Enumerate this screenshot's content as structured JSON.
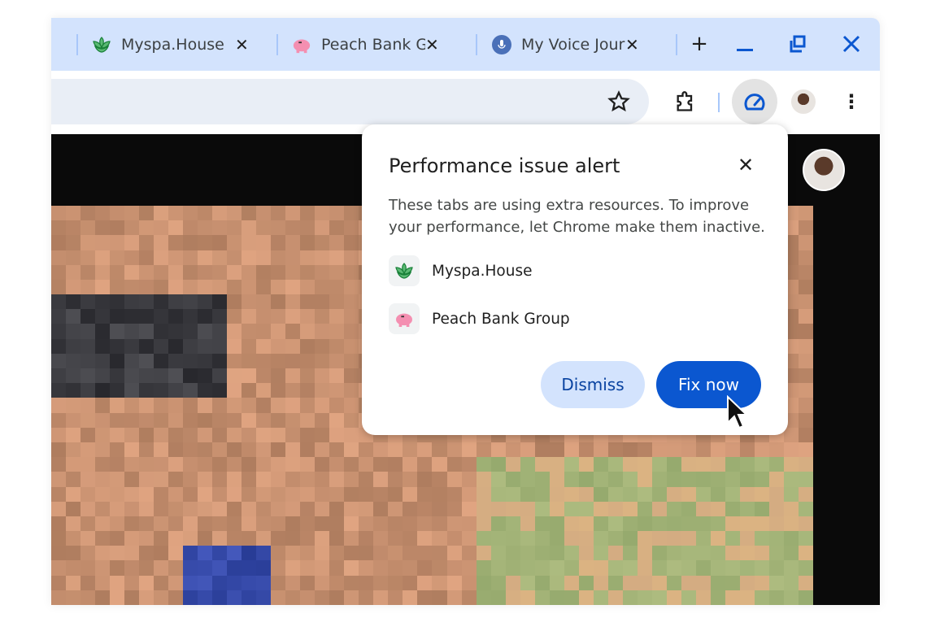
{
  "tabs": [
    {
      "title": "Myspa.House",
      "icon": "leaf-icon"
    },
    {
      "title": "Peach Bank Group",
      "icon": "piggy-bank-icon"
    },
    {
      "title": "My Voice Journal",
      "icon": "microphone-icon"
    }
  ],
  "window_controls": {
    "new_tab": "+",
    "minimize": "minimize-icon",
    "restore": "restore-icon",
    "close": "close-icon"
  },
  "popup": {
    "title": "Performance issue alert",
    "description": "These tabs are using extra resources. To improve your performance, let Chrome make them inactive.",
    "sites": [
      {
        "name": "Myspa.House",
        "icon": "leaf-icon"
      },
      {
        "name": "Peach Bank Group",
        "icon": "piggy-bank-icon"
      }
    ],
    "dismiss_label": "Dismiss",
    "fix_label": "Fix now"
  },
  "colors": {
    "tabstrip": "#d3e3fd",
    "accent": "#0b57d0",
    "omnibox": "#e9eef6"
  }
}
